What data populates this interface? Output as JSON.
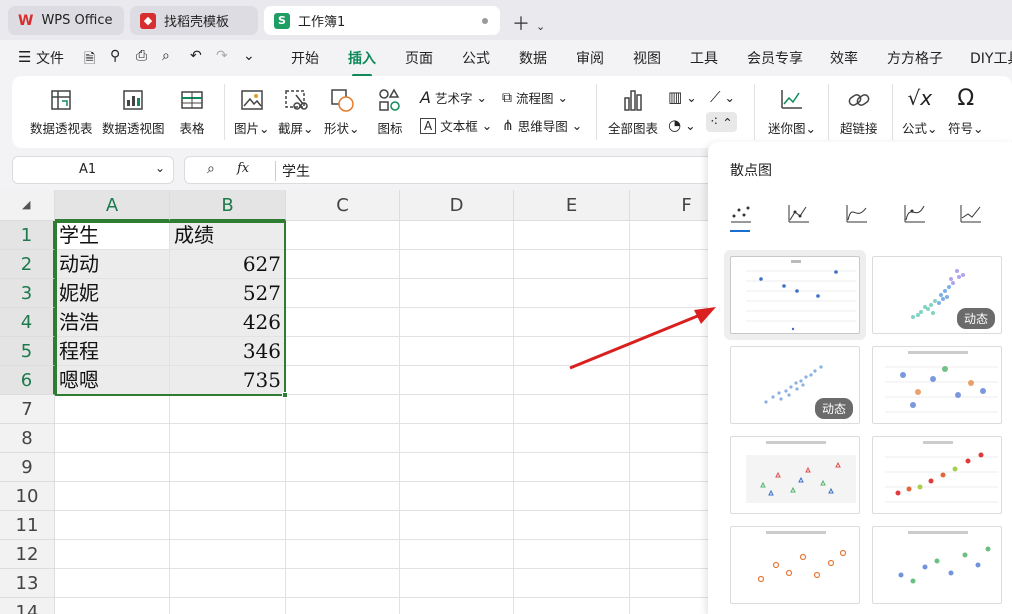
{
  "tabs": [
    {
      "label": "WPS Office",
      "logo": "W",
      "color": "#d72f2f"
    },
    {
      "label": "找稻壳模板",
      "logo": "",
      "color": "#d72f2f"
    },
    {
      "label": "工作簿1",
      "logo": "S",
      "color": "#1e9e62"
    }
  ],
  "menu": {
    "file": "文件",
    "items": [
      "开始",
      "插入",
      "页面",
      "公式",
      "数据",
      "审阅",
      "视图",
      "工具",
      "会员专享",
      "效率",
      "方方格子",
      "DIY工具"
    ],
    "active": "插入"
  },
  "ribbon": {
    "pivot_table": "数据透视表",
    "pivot_chart": "数据透视图",
    "table": "表格",
    "picture": "图片",
    "screenshot": "截屏",
    "shapes": "形状",
    "icons": "图标",
    "art_text": "艺术字",
    "text_box": "文本框",
    "flowchart": "流程图",
    "mindmap": "思维导图",
    "all_charts": "全部图表",
    "sparkline": "迷你图",
    "hyperlink": "超链接",
    "formula": "公式",
    "symbol": "符号"
  },
  "formula_bar": {
    "cell_ref": "A1",
    "fx": "fx",
    "content": "学生"
  },
  "columns": [
    "A",
    "B",
    "C",
    "D",
    "E",
    "F"
  ],
  "rows": [
    "1",
    "2",
    "3",
    "4",
    "5",
    "6",
    "7",
    "8",
    "9",
    "10",
    "11",
    "12",
    "13",
    "14"
  ],
  "cells": {
    "header": [
      "学生",
      "成绩"
    ],
    "data": [
      [
        "动动",
        "627"
      ],
      [
        "妮妮",
        "527"
      ],
      [
        "浩浩",
        "426"
      ],
      [
        "程程",
        "346"
      ],
      [
        "嗯嗯",
        "735"
      ]
    ]
  },
  "panel": {
    "title": "散点图",
    "badge": "动态",
    "chart_types": [
      "scatter-icon",
      "scatter-line-icon",
      "scatter-smooth-icon",
      "scatter-smooth-marker-icon",
      "scatter-straight-icon"
    ]
  },
  "colors": {
    "accent": "#118a5b",
    "selection": "#2e7d32",
    "arrow": "#d9201f"
  }
}
